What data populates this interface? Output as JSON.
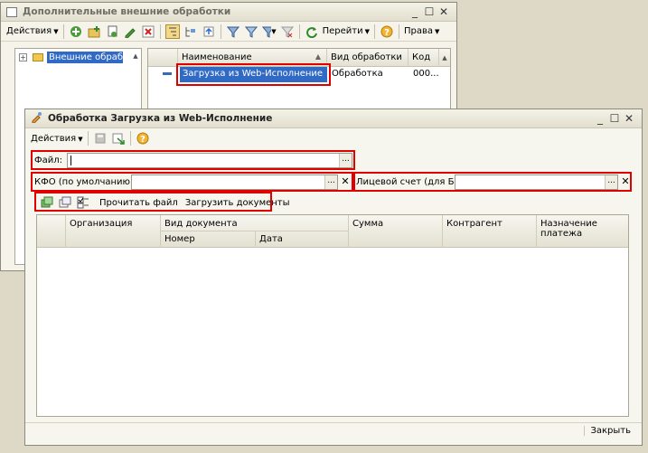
{
  "back_window": {
    "title": "Дополнительные внешние обработки",
    "toolbar": {
      "actions_label": "Действия",
      "goto_label": "Перейти",
      "rights_label": "Права"
    },
    "tree": {
      "root_label": "Внешние обработки"
    },
    "columns": {
      "name": "Наименование",
      "type": "Вид обработки",
      "code": "Код"
    },
    "rows": [
      {
        "name": "Загрузка из Web-Исполнение",
        "type": "Обработка",
        "code": "000..."
      }
    ]
  },
  "front_window": {
    "title": "Обработка Загрузка из Web-Исполнение",
    "toolbar": {
      "actions_label": "Действия"
    },
    "fields": {
      "file_label": "Файл:",
      "file_value": "",
      "kfo_label": "КФО (по умолчанию):",
      "kfo_value": "",
      "account_label": "Лицевой счет (для БО):",
      "account_value": ""
    },
    "actions": {
      "read_file": "Прочитать файл",
      "load_docs": "Загрузить документы"
    },
    "table_columns": {
      "org": "Организация",
      "doc_type": "Вид документа",
      "number": "Номер",
      "date": "Дата",
      "sum": "Сумма",
      "counterparty": "Контрагент",
      "purpose": "Назначение платежа"
    },
    "close_label": "Закрыть"
  },
  "colors": {
    "highlight": "#e00000",
    "selection": "#316ac5"
  }
}
